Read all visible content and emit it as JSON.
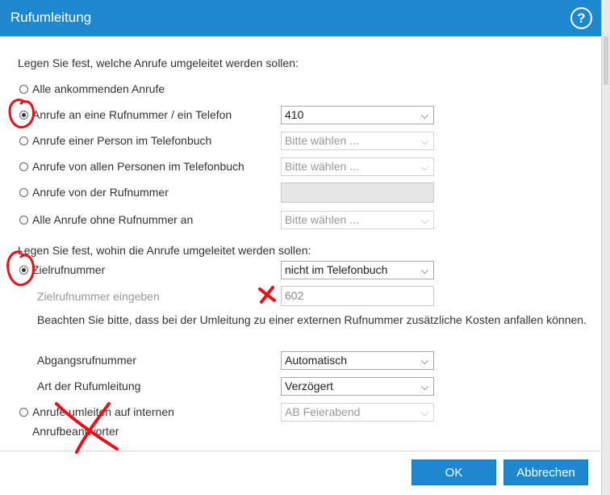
{
  "dialog": {
    "title": "Rufumleitung",
    "help_symbol": "?"
  },
  "section1": {
    "heading": "Legen Sie fest, welche Anrufe umgeleitet werden sollen:",
    "options": [
      {
        "label": "Alle ankommenden Anrufe",
        "checked": false
      },
      {
        "label": "Anrufe an eine Rufnummer / ein Telefon",
        "checked": true,
        "select": "410"
      },
      {
        "label": "Anrufe einer Person im Telefonbuch",
        "checked": false,
        "select": "Bitte wählen ..."
      },
      {
        "label": "Anrufe von allen Personen im Telefonbuch",
        "checked": false,
        "select": "Bitte wählen ..."
      },
      {
        "label": "Anrufe von der Rufnummer",
        "checked": false,
        "input": ""
      },
      {
        "label": "Alle Anrufe ohne Rufnummer an",
        "checked": false,
        "select": "Bitte wählen ..."
      }
    ]
  },
  "section2": {
    "heading": "Legen Sie fest, wohin die Anrufe umgeleitet werden sollen:",
    "target_label": "Zielrufnummer",
    "target_select": "nicht im Telefonbuch",
    "enter_label": "Zielrufnummer eingeben",
    "enter_value": "602",
    "notice": "Beachten Sie bitte, dass bei der Umleitung zu einer externen Rufnummer zusätzliche Kosten anfallen können.",
    "outgoing_label": "Abgangsrufnummer",
    "outgoing_value": "Automatisch",
    "type_label": "Art der Rufumleitung",
    "type_value": "Verzögert",
    "internal_label_line1": "Anrufe umleiten auf internen",
    "internal_label_line2": "Anrufbeantworter",
    "internal_select": "AB Feierabend"
  },
  "buttons": {
    "ok": "OK",
    "cancel": "Abbrechen"
  },
  "colors": {
    "title_bar": "#1e88cf",
    "annotation": "#e8101a"
  }
}
